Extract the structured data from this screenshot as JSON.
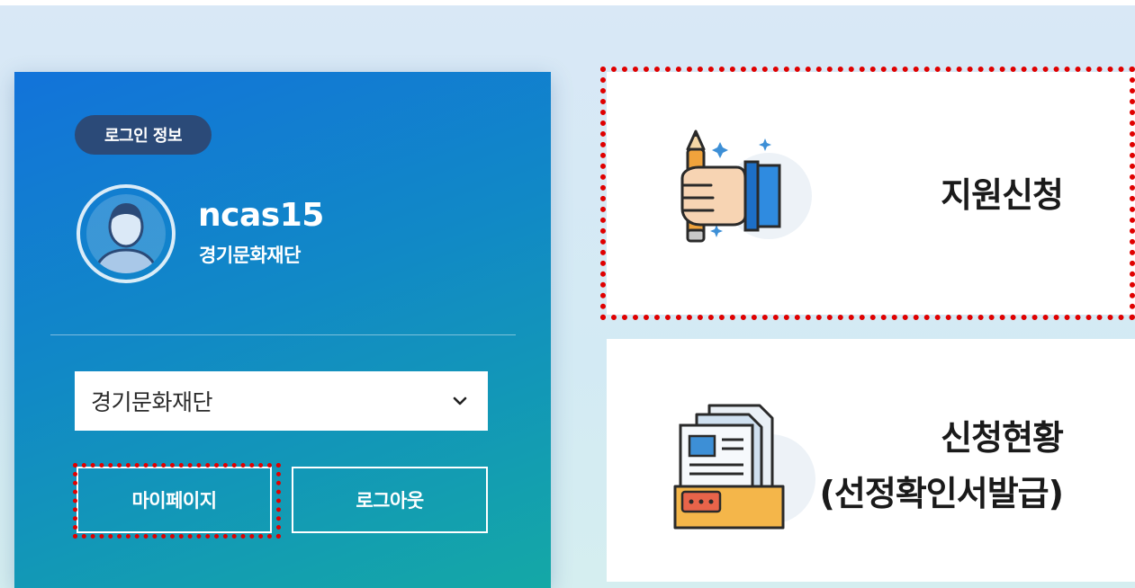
{
  "login": {
    "badge": "로그인 정보",
    "user_id": "ncas15",
    "organization": "경기문화재단",
    "select": {
      "selected": "경기문화재단"
    },
    "buttons": {
      "mypage": "마이페이지",
      "logout": "로그아웃"
    }
  },
  "cards": {
    "apply": {
      "title": "지원신청",
      "icon": "hand-pencil-icon"
    },
    "status": {
      "title_line1": "신청현황",
      "title_line2": "(선정확인서발급)",
      "icon": "documents-icon"
    }
  },
  "colors": {
    "panel_gradient_start": "#1273da",
    "panel_gradient_end": "#14a8a6",
    "badge_bg": "#2b4a78",
    "highlight_dashed": "#e00000",
    "card_bg": "#ffffff"
  }
}
